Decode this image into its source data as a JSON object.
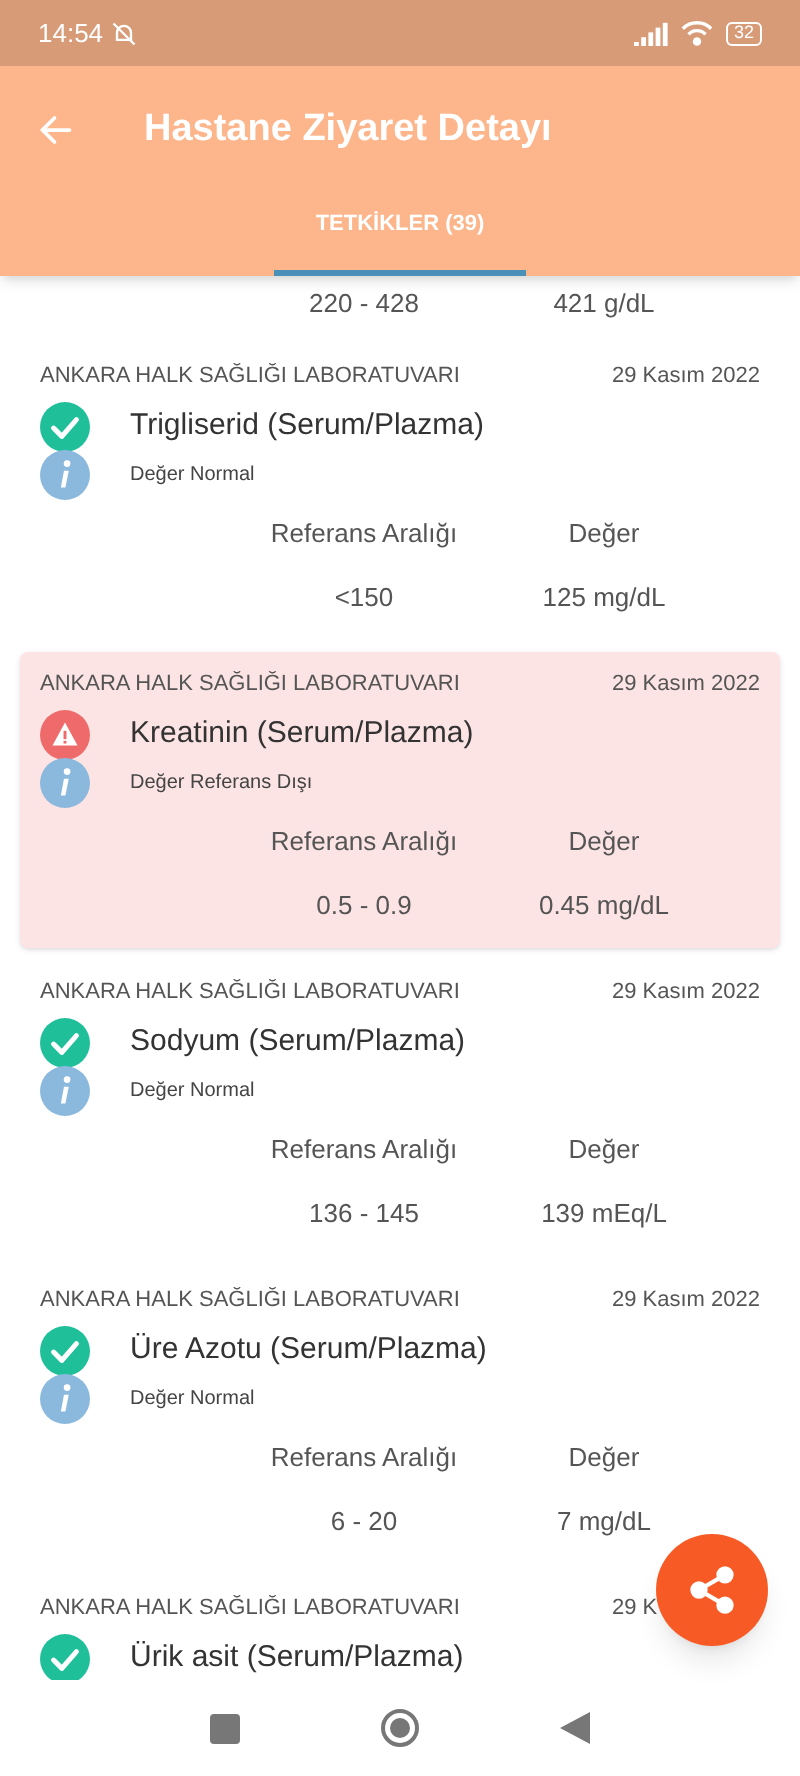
{
  "status_bar": {
    "time": "14:54",
    "battery": "32"
  },
  "header": {
    "title": "Hastane Ziyaret Detayı"
  },
  "tabs": [
    {
      "label": "TETKİKLER (39)",
      "selected": true
    }
  ],
  "partial_row": {
    "reference": "220 - 428",
    "value": "421 g/dL"
  },
  "results": [
    {
      "kind": "normal",
      "lab": "ANKARA HALK SAĞLIĞI LABORATUVARI",
      "date": "29 Kasım 2022",
      "name": "Trigliserid (Serum/Plazma)",
      "note": "Değer Normal",
      "reference_label": "Referans Aralığı",
      "value_label": "Değer",
      "reference": "<150",
      "value": "125 mg/dL"
    },
    {
      "kind": "out_of_range",
      "lab": "ANKARA HALK SAĞLIĞI LABORATUVARI",
      "date": "29 Kasım 2022",
      "name": "Kreatinin (Serum/Plazma)",
      "note": "Değer Referans Dışı",
      "reference_label": "Referans Aralığı",
      "value_label": "Değer",
      "reference": "0.5 - 0.9",
      "value": "0.45 mg/dL"
    },
    {
      "kind": "normal",
      "lab": "ANKARA HALK SAĞLIĞI LABORATUVARI",
      "date": "29 Kasım 2022",
      "name": "Sodyum (Serum/Plazma)",
      "note": "Değer Normal",
      "reference_label": "Referans Aralığı",
      "value_label": "Değer",
      "reference": "136 - 145",
      "value": "139 mEq/L"
    },
    {
      "kind": "normal",
      "lab": "ANKARA HALK SAĞLIĞI LABORATUVARI",
      "date": "29 Kasım 2022",
      "name": "Üre Azotu (Serum/Plazma)",
      "note": "Değer Normal",
      "reference_label": "Referans Aralığı",
      "value_label": "Değer",
      "reference": "6 - 20",
      "value": "7 mg/dL"
    },
    {
      "kind": "normal",
      "lab": "ANKARA HALK SAĞLIĞI LABORATUVARI",
      "date": "29 K",
      "name": "Ürik asit (Serum/Plazma)"
    }
  ]
}
